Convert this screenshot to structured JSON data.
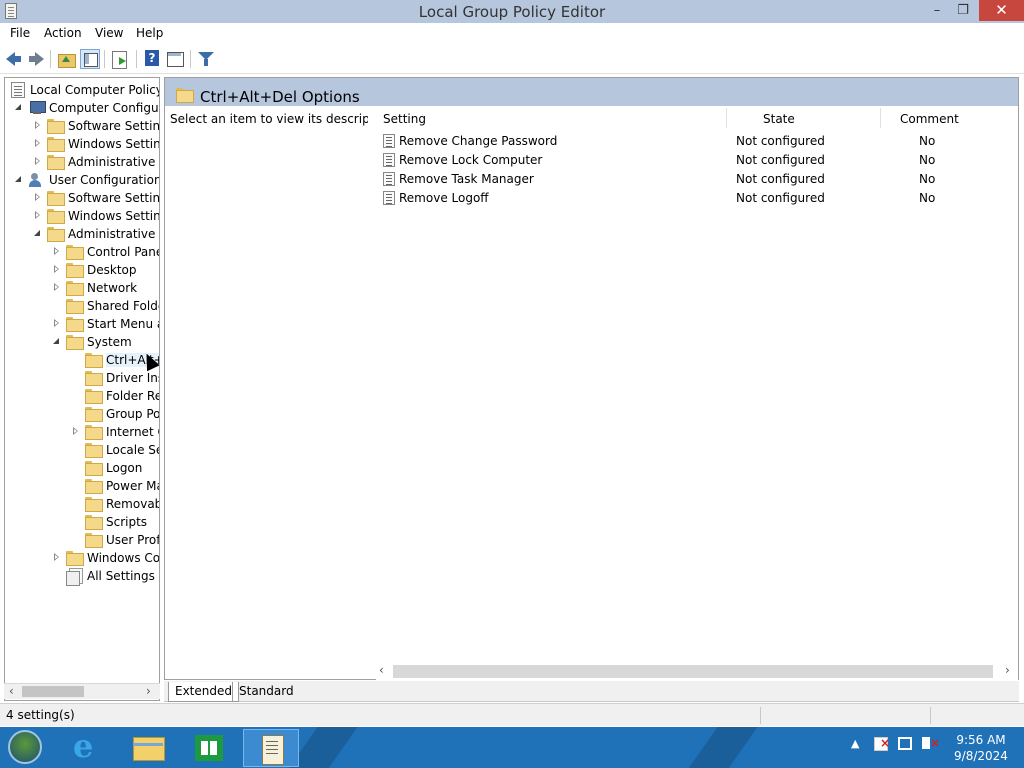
{
  "window": {
    "title": "Local Group Policy Editor",
    "min_glyph": "–",
    "max_glyph": "❐",
    "close_glyph": "✕"
  },
  "menu": {
    "file": "File",
    "action": "Action",
    "view": "View",
    "help": "Help"
  },
  "toolbar": {
    "icons": [
      "back-arrow-icon",
      "forward-arrow-icon",
      "up-folder-icon",
      "show-hide-tree-icon",
      "export-list-icon",
      "help-icon",
      "show-hide-action-pane-icon",
      "filter-icon"
    ]
  },
  "tree": {
    "root": "Local Computer Policy",
    "computer_config": "Computer Configura",
    "cc_software": "Software Settings",
    "cc_windows": "Windows Setting",
    "cc_admin": "Administrative Te",
    "user_config": "User Configuration",
    "uc_software": "Software Settings",
    "uc_windows": "Windows Setting",
    "uc_admin": "Administrative Te",
    "control_panel": "Control Panel",
    "desktop": "Desktop",
    "network": "Network",
    "shared_folders": "Shared Folder",
    "start_menu": "Start Menu ar",
    "system": "System",
    "ctrl_alt_del": "Ctrl+Alt+l",
    "driver_inst": "Driver Inst",
    "folder_red": "Folder Rec",
    "group_pol": "Group Pol",
    "internet_c": "Internet C",
    "locale_ser": "Locale Ser",
    "logon": "Logon",
    "power_ma": "Power Ma",
    "removabl": "Removabl",
    "scripts": "Scripts",
    "user_profi": "User Profi",
    "windows_cor": "Windows Cor",
    "all_settings": "All Settings",
    "scroll_left": "‹",
    "scroll_right": "›"
  },
  "main": {
    "header_title": "Ctrl+Alt+Del Options",
    "description": "Select an item to view its description.",
    "columns": {
      "setting": "Setting",
      "state": "State",
      "comment": "Comment"
    },
    "rows": [
      {
        "setting": "Remove Change Password",
        "state": "Not configured",
        "comment": "No"
      },
      {
        "setting": "Remove Lock Computer",
        "state": "Not configured",
        "comment": "No"
      },
      {
        "setting": "Remove Task Manager",
        "state": "Not configured",
        "comment": "No"
      },
      {
        "setting": "Remove Logoff",
        "state": "Not configured",
        "comment": "No"
      }
    ],
    "scroll_left": "‹",
    "scroll_right": "›"
  },
  "tabs": {
    "extended": "Extended",
    "standard": "Standard"
  },
  "status": {
    "text": "4 setting(s)"
  },
  "taskbar": {
    "apps": [
      "start-button",
      "internet-explorer-icon",
      "file-explorer-icon",
      "store-icon",
      "group-policy-editor-icon"
    ],
    "tray_chevron": "▲",
    "time": "9:56 AM",
    "date": "9/8/2024"
  }
}
